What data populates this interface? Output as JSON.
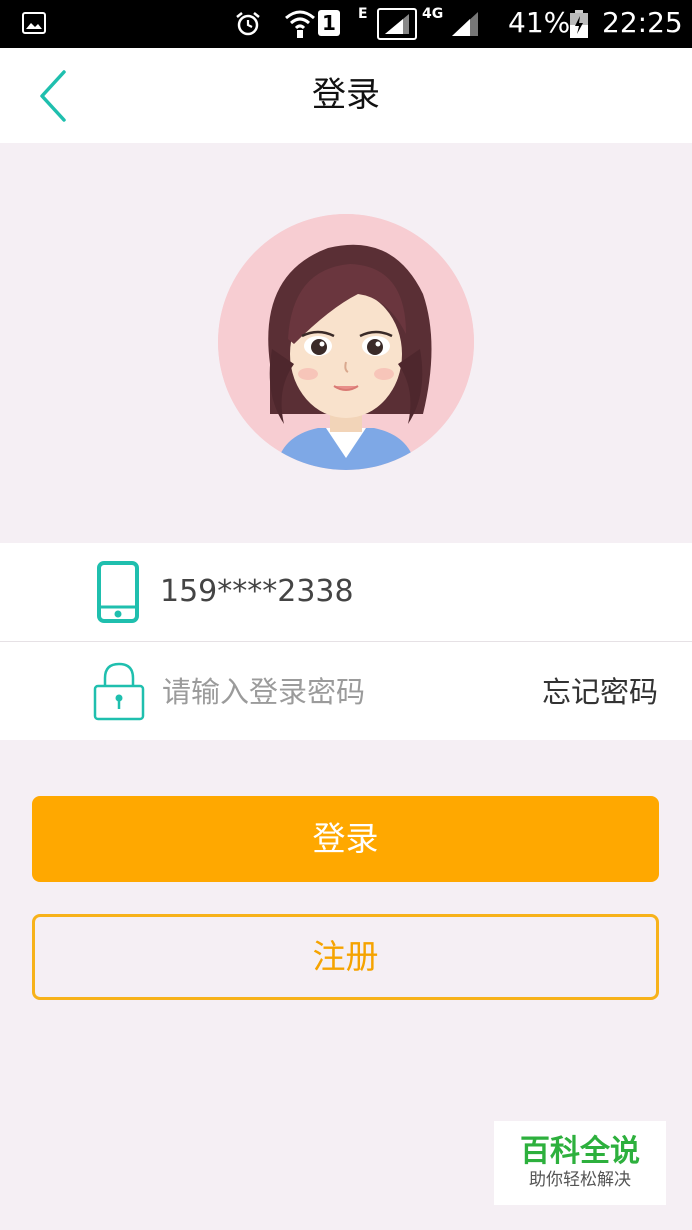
{
  "status_bar": {
    "sim_slot": "1",
    "network_e": "E",
    "network_4g": "4G",
    "battery": "41%",
    "time": "22:25",
    "icons": [
      "gallery-icon",
      "alarm-icon",
      "wifi-icon",
      "signal-icon",
      "battery-icon"
    ]
  },
  "header": {
    "title": "登录",
    "back_icon": "chevron-left-icon"
  },
  "colors": {
    "accent_teal": "#1fbfae",
    "primary_orange": "#ffa800",
    "page_bg": "#f5eff4"
  },
  "form": {
    "phone_value": "159****2338",
    "password_placeholder": "请输入登录密码",
    "forgot_label": "忘记密码"
  },
  "buttons": {
    "login": "登录",
    "register": "注册"
  },
  "watermark": {
    "title": "百科全说",
    "subtitle": "助你轻松解决"
  }
}
